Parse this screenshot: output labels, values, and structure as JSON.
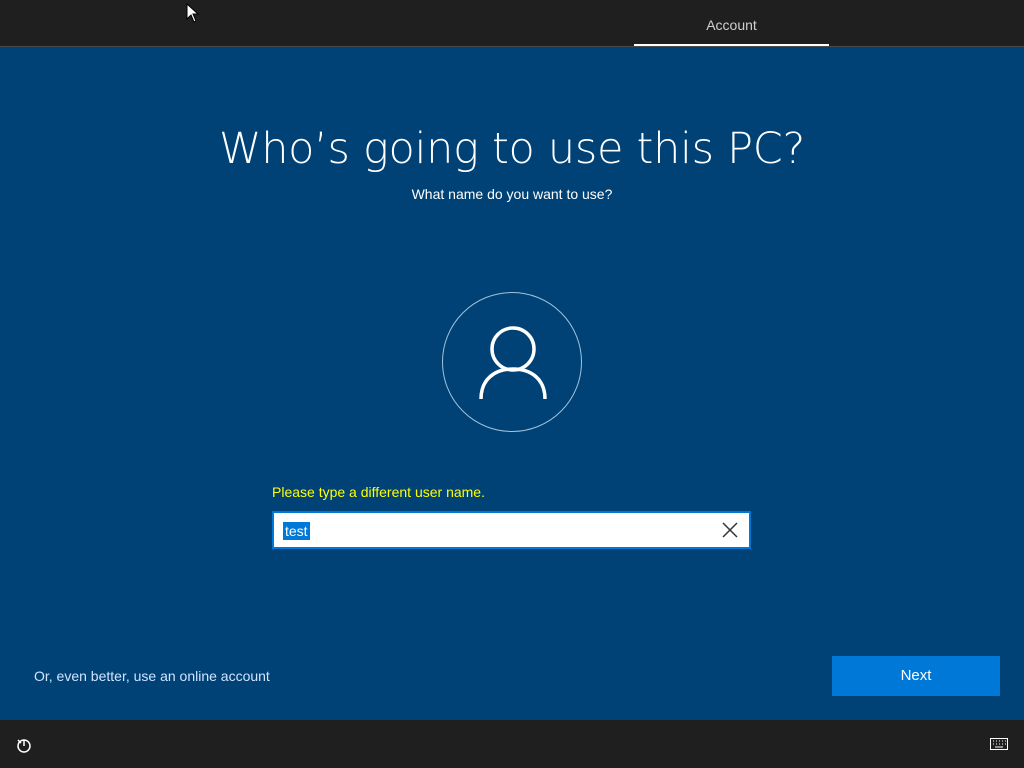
{
  "header": {
    "tab_label": "Account"
  },
  "main": {
    "title": "Who’s going to use this PC?",
    "subtitle": "What name do you want to use?",
    "avatar_icon": "user-icon",
    "error_message": "Please type a different user name.",
    "username_value": "test",
    "online_account_link": "Or, even better, use an online account",
    "next_label": "Next"
  },
  "footer": {
    "left_icon": "accessibility-icon",
    "right_icon": "keyboard-icon"
  },
  "colors": {
    "background": "#004275",
    "accent": "#0078d7",
    "error": "#ffff00",
    "bar": "#1f1f1f"
  }
}
